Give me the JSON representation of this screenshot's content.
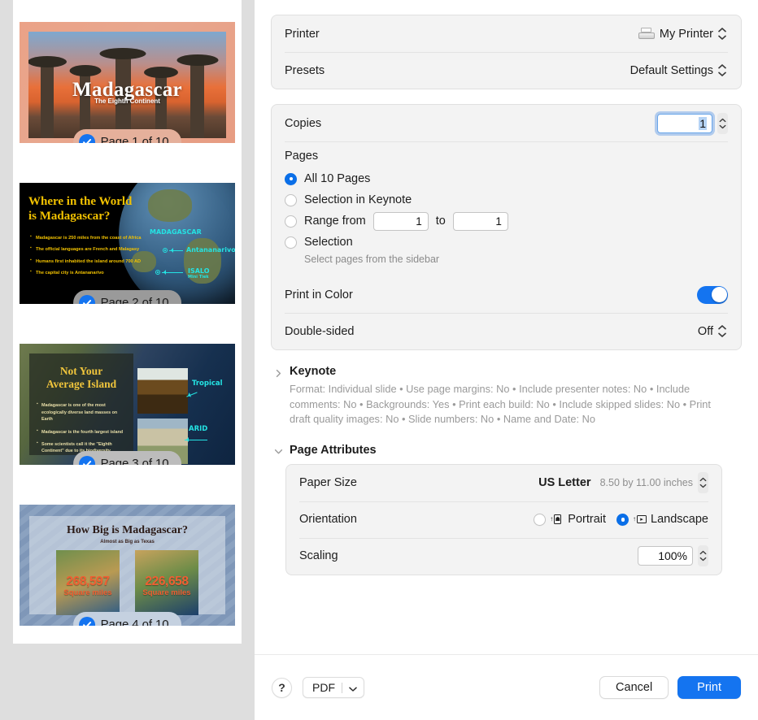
{
  "sidebar": {
    "slides": [
      {
        "page_label": "Page 1 of 10",
        "title": "Madagascar",
        "subtitle": "The Eighth Continent",
        "badge_bg": "#e5b09b"
      },
      {
        "page_label": "Page 2 of 10",
        "title_line1": "Where in the World",
        "title_line2": "is Madagascar?",
        "bullets": [
          "Madagascar is 250 miles from the coast of Africa",
          "The official languages are French and Malagasy",
          "Humans first inhabited the island around 700 AD",
          "The capital city is Antananarivo"
        ],
        "label_country": "MADAGASCAR",
        "label_capital": "Antananarivo",
        "label_park": "ISALO",
        "label_park_sub": "Mini Tiek",
        "badge_bg": "#9a9a9a"
      },
      {
        "page_label": "Page 3 of 10",
        "title_line1": "Not Your",
        "title_line2": "Average Island",
        "bullets": [
          "Madagascar is one of the most ecologically diverse land masses on Earth",
          "Madagascar is the fourth largest island",
          "Some scientists call it the \"Eighth Continent\" due to its biodiversity"
        ],
        "label_tropical": "Tropical",
        "label_arid": "ARID",
        "badge_bg": "#bcbcbc"
      },
      {
        "page_label": "Page 4 of 10",
        "title": "How Big is Madagascar?",
        "subtitle": "Almost as Big as Texas",
        "stat_left_number": "268,597",
        "stat_left_unit": "Square miles",
        "stat_right_number": "226,658",
        "stat_right_unit": "Square miles",
        "badge_bg": "#c5d1e0"
      }
    ]
  },
  "main": {
    "printer": {
      "label": "Printer",
      "value": "My Printer"
    },
    "presets": {
      "label": "Presets",
      "value": "Default Settings"
    },
    "copies": {
      "label": "Copies",
      "value": "1"
    },
    "pages": {
      "title": "Pages",
      "options": [
        {
          "label": "All 10 Pages",
          "selected": true
        },
        {
          "label": "Selection in Keynote",
          "selected": false
        },
        {
          "label": "Range from",
          "selected": false
        },
        {
          "label": "Selection",
          "selected": false
        }
      ],
      "range_to_label": "to",
      "range_from_value": "1",
      "range_to_value": "1",
      "selection_hint": "Select pages from the sidebar"
    },
    "print_in_color": {
      "label": "Print in Color",
      "state": "on"
    },
    "double_sided": {
      "label": "Double-sided",
      "value": "Off"
    },
    "keynote": {
      "title": "Keynote",
      "expanded": false,
      "description": "Format: Individual slide • Use page margins: No • Include presenter notes: No • Include comments: No • Backgrounds: Yes • Print each build: No • Include skipped slides: No • Print draft quality images: No • Slide numbers: No • Name and Date: No"
    },
    "page_attributes": {
      "title": "Page Attributes",
      "expanded": true,
      "paper_size": {
        "label": "Paper Size",
        "value": "US Letter",
        "detail": "8.50 by 11.00 inches"
      },
      "orientation": {
        "label": "Orientation",
        "options": [
          {
            "label": "Portrait",
            "selected": false
          },
          {
            "label": "Landscape",
            "selected": true
          }
        ]
      },
      "scaling": {
        "label": "Scaling",
        "value": "100%"
      }
    }
  },
  "footer": {
    "help_label": "?",
    "pdf_label": "PDF",
    "cancel_label": "Cancel",
    "print_label": "Print"
  },
  "colors": {
    "accent": "#1474f0",
    "radio_on": "#0a6fe8",
    "sidebar_bg": "#dedede"
  }
}
